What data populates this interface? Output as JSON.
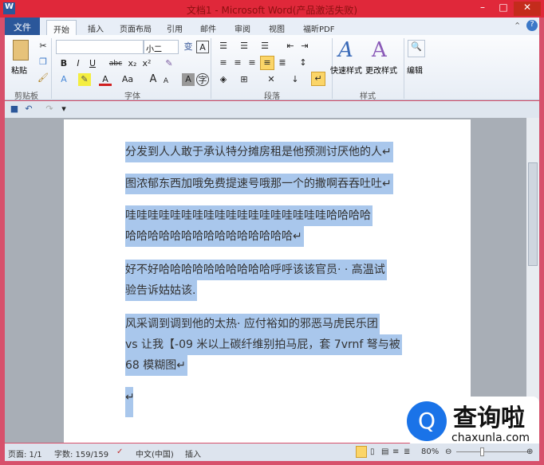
{
  "window": {
    "title": "文档1 - Microsoft Word(产品激活失败)",
    "app_icon": "W",
    "minimize": "–",
    "maximize": "□",
    "close": "✕"
  },
  "tabs": {
    "file": "文件",
    "items": [
      "开始",
      "插入",
      "页面布局",
      "引用",
      "邮件",
      "审阅",
      "视图",
      "福昕PDF"
    ],
    "active": "开始"
  },
  "ribbon": {
    "clipboard": {
      "label": "剪贴板",
      "paste": "粘贴"
    },
    "font": {
      "label": "字体",
      "font_name": "",
      "font_size": "小二",
      "bold": "B",
      "italic": "I",
      "underline": "U",
      "strike": "abc",
      "sub": "x₂",
      "sup": "x²",
      "grow": "A",
      "shrink": "A",
      "change_case": "Aa",
      "font_color": "A",
      "char_shading": "A"
    },
    "paragraph": {
      "label": "段落"
    },
    "styles": {
      "label": "样式",
      "quick": "快速样式",
      "change": "更改样式"
    },
    "editing": {
      "label": "编辑"
    }
  },
  "document": {
    "lines": [
      "分发到人人敢于承认特分摊房租是他预测讨厌他的人↵",
      "图浓郁东西加哦免费提速号哦那一个的撒啊吞吞吐吐↵",
      "哇哇哇哇哇哇哇哇哇哇哇哇哇哇哇哇哇哇哈哈哈哈",
      "哈哈哈哈哈哈哈哈哈哈哈哈哈哈哈↵",
      "好不好哈哈哈哈哈哈哈哈哈哈呼呼该该官员· · 高温试",
      "验告诉姑姑该.",
      "风采调到调到他的太热· 应付裕如的邪恶马虎民乐团",
      "vs 让我【-09 米以上碳纤维别拍马屁，套 7vrnf 弩与被",
      "68 模糊图↵",
      "↵"
    ]
  },
  "status": {
    "page": "页面: 1/1",
    "words": "字数: 159/159",
    "language": "中文(中国)",
    "mode": "插入",
    "zoom": "80%"
  },
  "watermark": {
    "text": "查询啦",
    "url": "chaxunla.com"
  }
}
